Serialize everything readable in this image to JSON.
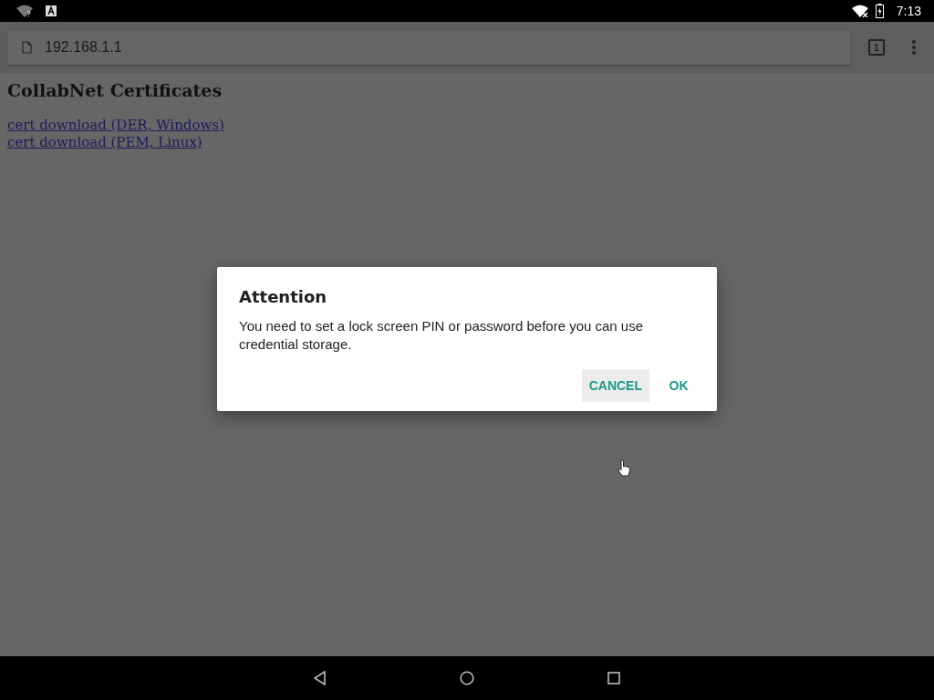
{
  "status_bar": {
    "time": "7:13"
  },
  "browser": {
    "url": "192.168.1.1",
    "tab_count": "1"
  },
  "page": {
    "heading": "CollabNet Certificates",
    "links": [
      "cert download (DER, Windows)",
      "cert download (PEM, Linux)"
    ]
  },
  "dialog": {
    "title": "Attention",
    "message": "You need to set a lock screen PIN or password before you can use credential storage.",
    "buttons": [
      {
        "label": "CANCEL",
        "highlighted": true
      },
      {
        "label": "OK",
        "highlighted": false
      }
    ]
  }
}
